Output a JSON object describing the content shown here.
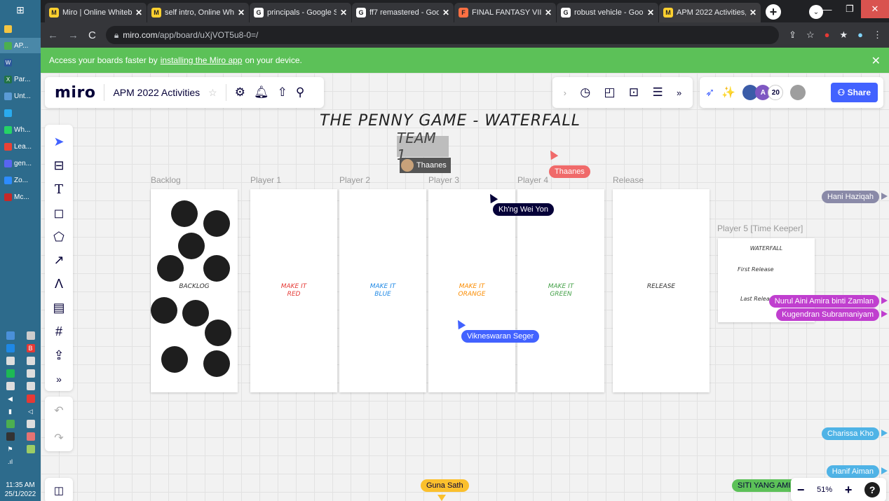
{
  "taskbar": {
    "items": [
      {
        "label": "AP...",
        "color": "#4caf50"
      },
      {
        "label": "",
        "color": "#2b579a",
        "glyph": "W"
      },
      {
        "label": "Par...",
        "color": "#217346",
        "glyph": "X"
      },
      {
        "label": "Unt...",
        "color": "#5b9bd5"
      },
      {
        "label": "",
        "color": "#2aabee"
      },
      {
        "label": "Wh...",
        "color": "#25d366"
      },
      {
        "label": "Lea...",
        "color": "#e94235"
      },
      {
        "label": "gen...",
        "color": "#5865f2"
      },
      {
        "label": "Zo...",
        "color": "#2d8cff"
      },
      {
        "label": "Mc...",
        "color": "#c62828"
      }
    ],
    "clock_time": "11:35 AM",
    "clock_date": "25/1/2022"
  },
  "browser": {
    "tabs": [
      {
        "title": "Miro | Online Whiteb",
        "fav": "M",
        "fav_color": "#ffd02f"
      },
      {
        "title": "self intro, Online Whi",
        "fav": "M",
        "fav_color": "#ffd02f"
      },
      {
        "title": "principals - Google S",
        "fav": "G",
        "fav_color": "#ffffff"
      },
      {
        "title": "ff7 remastered - Goo",
        "fav": "G",
        "fav_color": "#ffffff"
      },
      {
        "title": "FINAL FANTASY VII fo",
        "fav": "F",
        "fav_color": "#ff7043"
      },
      {
        "title": "robust vehicle - Goo",
        "fav": "G",
        "fav_color": "#ffffff"
      },
      {
        "title": "APM 2022 Activities,",
        "fav": "M",
        "fav_color": "#ffd02f"
      }
    ],
    "url_host": "miro.com",
    "url_path": "/app/board/uXjVOT5u8-0=/",
    "banner_pre": "Access your boards faster by",
    "banner_link": "installing the Miro app",
    "banner_post": "on your device."
  },
  "miro": {
    "logo": "miro",
    "board_name": "APM 2022 Activities",
    "share_label": "Share",
    "collab_count": "20",
    "zoom": "51%"
  },
  "board": {
    "title": "THE PENNY GAME - WATERFALL",
    "team": "TEAM 1",
    "team_member": "Thaanes",
    "columns": [
      {
        "label": "Backlog",
        "text": "BACKLOG",
        "color": "#333333"
      },
      {
        "label": "Player 1",
        "text": "MAKE IT\nRED",
        "color": "#e53935"
      },
      {
        "label": "Player 2",
        "text": "MAKE IT\nBLUE",
        "color": "#1e88e5"
      },
      {
        "label": "Player 3",
        "text": "MAKE IT\nORANGE",
        "color": "#fb8c00"
      },
      {
        "label": "Player 4",
        "text": "MAKE IT\nGREEN",
        "color": "#43a047"
      },
      {
        "label": "Release",
        "text": "RELEASE",
        "color": "#333333"
      }
    ],
    "player5": {
      "label": "Player 5 [Time Keeper]",
      "title": "WATERFALL",
      "first": "First Release",
      "last": "Last Release"
    }
  },
  "cursors": {
    "thaanes": "Thaanes",
    "khng": "Kh'ng Wei Yon",
    "vikneswaran": "Vikneswaran Seger",
    "guna": "Guna Sath",
    "hani": "Hani Haziqah",
    "nurul": "Nurul Aini Amira binti Zamlan",
    "kugendran": "Kugendran Subramaniyam",
    "charissa": "Charissa Kho",
    "hanif": "Hanif Aiman",
    "siti": "SITI YANG AMIN"
  }
}
